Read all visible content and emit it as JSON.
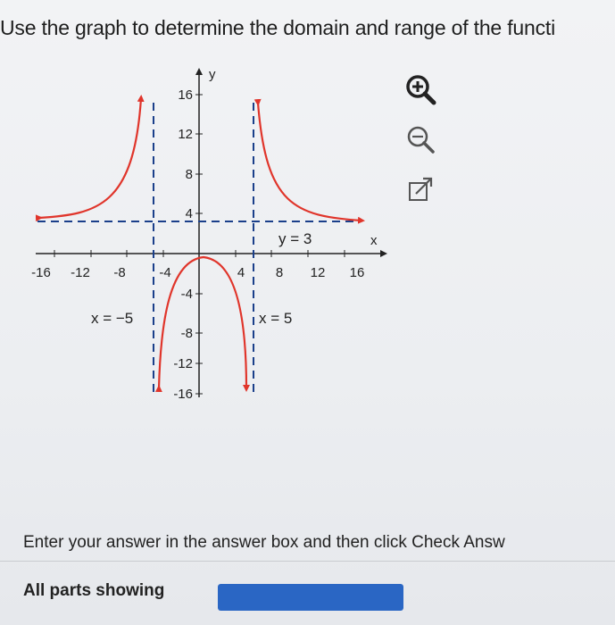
{
  "question": {
    "text": "Use the graph to determine the domain and range of the functi"
  },
  "graph": {
    "axis_label_x": "x",
    "axis_label_y": "y",
    "x_ticks": [
      "-16",
      "-12",
      "-8",
      "-4",
      "4",
      "8",
      "12",
      "16"
    ],
    "y_ticks": [
      "16",
      "12",
      "8",
      "4",
      "-4",
      "-8",
      "-12",
      "-16"
    ],
    "annotation_y3": "y = 3",
    "annotation_x_neg5": "x = −5",
    "annotation_x5": "x = 5",
    "curve_color": "#e0352b",
    "asymptote_color": "#1a3f8a"
  },
  "tools": {
    "zoom_in": "zoom-in-icon",
    "zoom_out": "zoom-out-icon",
    "popout": "external-link-icon"
  },
  "footer": {
    "instruction": "Enter your answer in the answer box and then click Check Answ",
    "parts_label": "All parts showing",
    "progress": 1.0,
    "progress_color": "#2a66c4"
  }
}
